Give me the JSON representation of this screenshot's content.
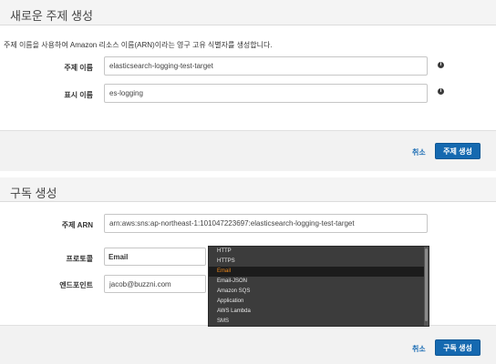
{
  "topic_panel": {
    "title": "새로운 주제 생성",
    "description": "주제 이름을 사용하여 Amazon 리소스 이름(ARN)이라는 영구 고유 식별자를 생성합니다.",
    "topic_name_label": "주제 이름",
    "topic_name_value": "elasticsearch-logging-test-target",
    "display_name_label": "표시 이름",
    "display_name_value": "es-logging",
    "info_icon": "i",
    "cancel_label": "취소",
    "create_label": "주제 생성"
  },
  "subscription_panel": {
    "title": "구독 생성",
    "topic_arn_label": "주제 ARN",
    "topic_arn_value": "arn:aws:sns:ap-northeast-1:101047223697:elasticsearch-logging-test-target",
    "protocol_label": "프로토콜",
    "protocol_value": "Email",
    "endpoint_label": "엔드포인트",
    "endpoint_value": "jacob@buzzni.com",
    "protocol_options": [
      "HTTP",
      "HTTPS",
      "Email",
      "Email-JSON",
      "Amazon SQS",
      "Application",
      "AWS Lambda",
      "SMS"
    ],
    "selected_option": "Email",
    "cancel_label": "취소",
    "create_label": "구독 생성"
  },
  "colors": {
    "primary_button": "#1569b0",
    "link": "#1f6fb5",
    "dropdown_bg": "#3c3c3c",
    "dropdown_selected_text": "#f08a1c"
  }
}
